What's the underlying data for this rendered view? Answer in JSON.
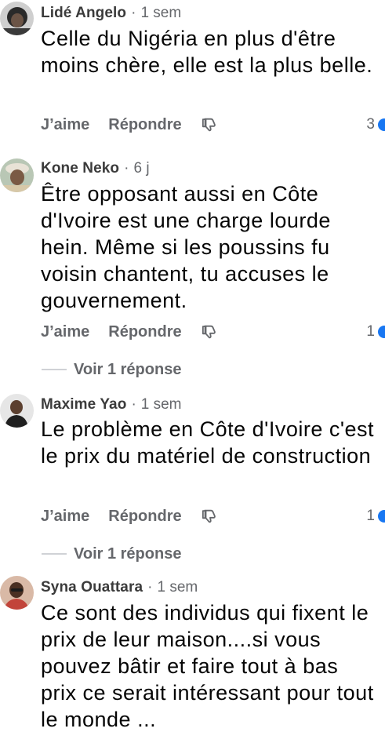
{
  "actions": {
    "like": "J’aime",
    "reply": "Répondre"
  },
  "colors": {
    "accent": "#1877f2",
    "muted": "#65676b"
  },
  "comments": [
    {
      "author": "Lidé Angelo",
      "time": "1 sem",
      "text": "Celle du Nigéria en plus d'être moins chère, elle est la plus belle.",
      "reactions": "3",
      "replies_label": ""
    },
    {
      "author": "Kone Neko",
      "time": "6 j",
      "text": "Être opposant aussi en Côte d'Ivoire est une charge lourde hein. Même si les poussins fu voisin chantent, tu accuses le gouvernement.",
      "reactions": "1",
      "replies_label": "Voir 1 réponse"
    },
    {
      "author": "Maxime Yao",
      "time": "1 sem",
      "text": "Le problème en Côte d'Ivoire c'est le prix du matériel de construction",
      "reactions": "1",
      "replies_label": "Voir 1 réponse"
    },
    {
      "author": "Syna Ouattara",
      "time": "1 sem",
      "text": "Ce sont des individus qui fixent le prix de leur maison....si vous pouvez bâtir et faire tout à bas prix ce serait intéressant pour tout le monde ...",
      "reactions": "",
      "replies_label": ""
    }
  ]
}
